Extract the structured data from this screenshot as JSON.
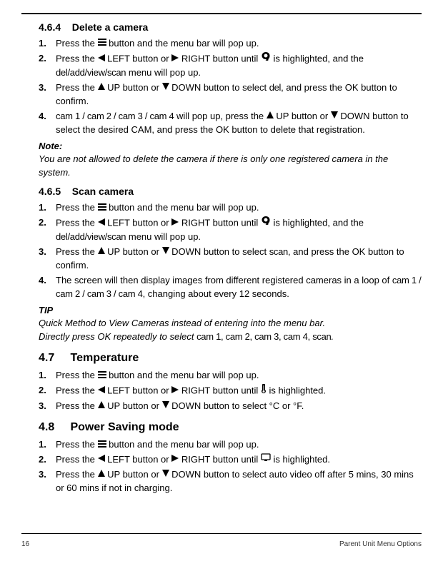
{
  "section_464": {
    "num": "4.6.4",
    "title": "Delete a camera",
    "steps": [
      {
        "n": "1.",
        "a": "Press the ",
        "b": " button and the menu bar will pop up."
      },
      {
        "n": "2.",
        "a": "Press the ",
        "b": " LEFT button or ",
        "c": " RIGHT button until ",
        "d": " is highlighted, and the ",
        "e": "del/add/view/scan",
        "f": " menu will pop up."
      },
      {
        "n": "3.",
        "a": "Press the ",
        "b": " UP button or ",
        "c": " DOWN button to select ",
        "d": "del",
        "e": ", and press the OK button to confirm."
      },
      {
        "n": "4.",
        "a": "cam 1 / cam 2 / cam 3 / cam 4",
        "b": " will pop up, press the ",
        "c": " UP button or ",
        "d": " DOWN button to select the desired CAM, and press the OK button to delete that registration."
      }
    ],
    "note_label": "Note:",
    "note_text": "You are not allowed to delete the camera if there is only one registered camera in the system."
  },
  "section_465": {
    "num": "4.6.5",
    "title": "Scan camera",
    "steps": [
      {
        "n": "1.",
        "a": "Press the ",
        "b": " button and the menu bar will pop up."
      },
      {
        "n": "2.",
        "a": "Press the ",
        "b": " LEFT button or ",
        "c": " RIGHT button until ",
        "d": " is highlighted, and the ",
        "e": "del/add/view/scan",
        "f": " menu will pop up."
      },
      {
        "n": "3.",
        "a": "Press the ",
        "b": " UP button or ",
        "c": " DOWN button to select ",
        "d": "scan",
        "e": ", and press the OK button to confirm."
      },
      {
        "n": "4.",
        "a": "The screen will then display images from different registered cameras in a loop of ",
        "b": "cam 1 / cam 2 / cam 3 / cam 4",
        "c": ", changing about every 12 seconds."
      }
    ],
    "tip_label": "TIP",
    "tip_line1": "Quick Method to View Cameras instead of entering into the menu bar.",
    "tip_line2a": "Directly press OK repeatedly to select ",
    "tip_line2b": "cam 1, cam 2, cam 3, cam 4, scan",
    "tip_line2c": "."
  },
  "section_47": {
    "num": "4.7",
    "title": "Temperature",
    "steps": [
      {
        "n": "1.",
        "a": "Press the ",
        "b": " button and the menu bar will pop up."
      },
      {
        "n": "2.",
        "a": "Press the ",
        "b": " LEFT button or ",
        "c": " RIGHT button until ",
        "d": " is highlighted."
      },
      {
        "n": "3.",
        "a": "Press the ",
        "b": " UP button or ",
        "c": " DOWN button to select °C or °F."
      }
    ]
  },
  "section_48": {
    "num": "4.8",
    "title": "Power Saving mode",
    "steps": [
      {
        "n": "1.",
        "a": "Press the ",
        "b": " button and the menu bar will pop up."
      },
      {
        "n": "2.",
        "a": "Press the ",
        "b": " LEFT button or ",
        "c": " RIGHT button until ",
        "d": " is highlighted."
      },
      {
        "n": "3.",
        "a": "Press the ",
        "b": " UP button or ",
        "c": " DOWN button to select auto video off after 5 mins, 30 mins or 60 mins if not in charging."
      }
    ]
  },
  "footer": {
    "page": "16",
    "section": "Parent Unit Menu Options"
  }
}
